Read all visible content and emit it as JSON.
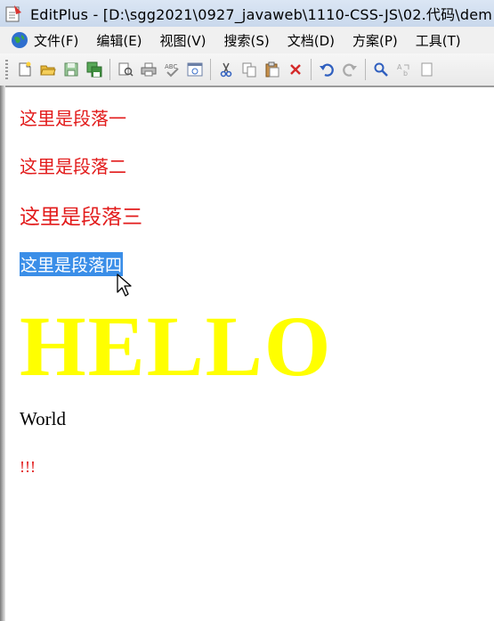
{
  "window": {
    "title": "EditPlus - [D:\\sgg2021\\0927_javaweb\\1110-CSS-JS\\02.代码\\dem"
  },
  "menu": {
    "items": [
      "文件(F)",
      "编辑(E)",
      "视图(V)",
      "搜索(S)",
      "文档(D)",
      "方案(P)",
      "工具(T)"
    ]
  },
  "toolbar": {
    "buttons": [
      "new-file-icon",
      "open-folder-icon",
      "save-icon",
      "save-all-icon",
      "print-preview-icon",
      "print-icon",
      "spell-check-icon",
      "browser-view-icon",
      "cut-icon",
      "copy-icon",
      "paste-icon",
      "delete-icon",
      "undo-icon",
      "redo-icon",
      "find-icon",
      "replace-icon"
    ]
  },
  "content": {
    "paragraph1": "这里是段落一",
    "paragraph2": "这里是段落二",
    "paragraph3": "这里是段落三",
    "paragraph4": "这里是段落四",
    "hello": "HELLO",
    "world": "World",
    "exclaim": "!!!"
  },
  "colors": {
    "paragraph_text": "#e21b1b",
    "selection_bg": "#3a8ee8",
    "hello_text": "#ffff00",
    "world_text": "#000000"
  }
}
